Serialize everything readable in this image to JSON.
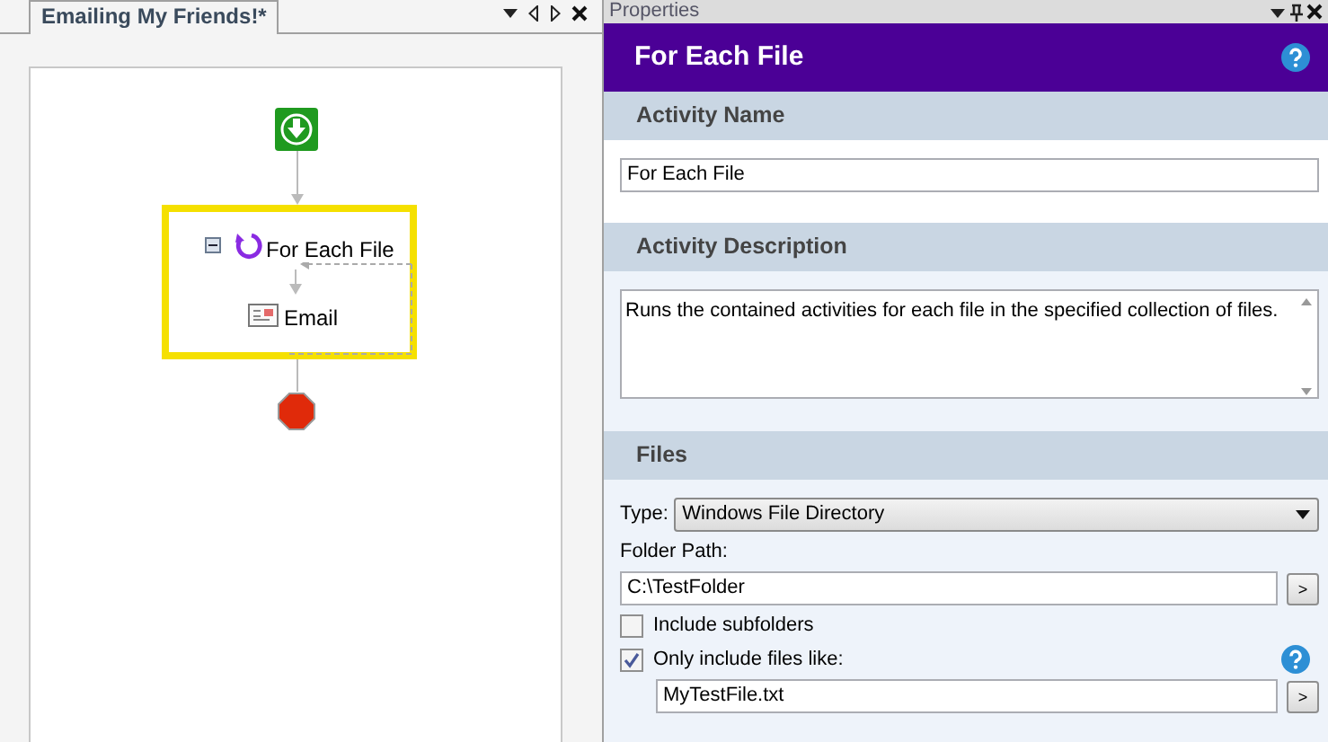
{
  "document_tab": {
    "title": "Emailing My Friends!*",
    "selected": true
  },
  "workflow": {
    "nodes": [
      {
        "kind": "start"
      },
      {
        "kind": "loop",
        "label": "For Each File",
        "expanded": true,
        "selected": true,
        "children": [
          {
            "kind": "email",
            "label": "Email"
          }
        ]
      },
      {
        "kind": "stop"
      }
    ]
  },
  "properties": {
    "title": "Properties",
    "header": "For Each File",
    "activity_name": {
      "title": "Activity Name",
      "value": "For Each File"
    },
    "activity_description": {
      "title": "Activity Description",
      "value": "Runs the contained activities for each file in the specified collection of files."
    },
    "files": {
      "title": "Files",
      "type_label": "Type:",
      "type_value": "Windows File Directory",
      "folder_label": "Folder Path:",
      "folder_value": "C:\\TestFolder",
      "folder_button": ">",
      "options": [
        {
          "label": "Include subfolders",
          "checked": false
        },
        {
          "label": "Only include files like:",
          "checked": true
        }
      ],
      "pattern_value": "MyTestFile.txt",
      "pattern_button": ">"
    }
  }
}
